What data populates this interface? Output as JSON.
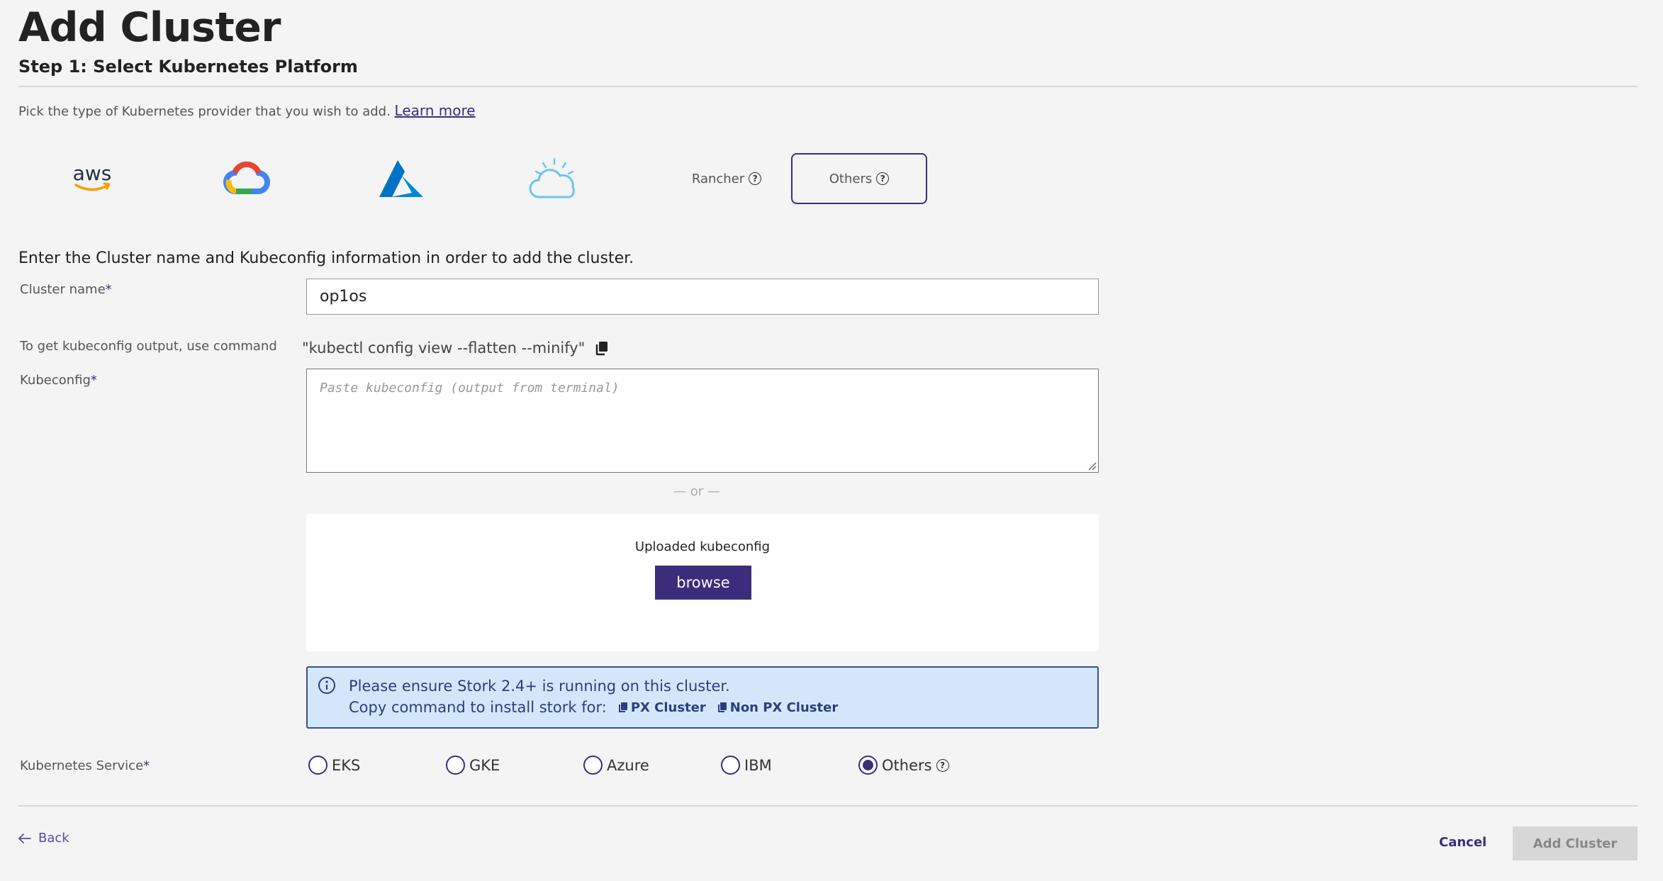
{
  "header": {
    "title": "Add Cluster",
    "step": "Step 1: Select Kubernetes Platform"
  },
  "intro": {
    "text": "Pick the type of Kubernetes provider that you wish to add.",
    "learn_more": "Learn more"
  },
  "providers": {
    "aws_icon": "aws-logo",
    "gcp_icon": "google-cloud-logo",
    "azure_icon": "azure-logo",
    "ibm_icon": "ibm-cloud-logo",
    "rancher": "Rancher",
    "others": "Others"
  },
  "form": {
    "intro": "Enter the Cluster name and Kubeconfig information in order to add the cluster.",
    "cluster_name_label": "Cluster name",
    "required_mark": "*",
    "cluster_name_value": "op1os",
    "kubeconfig_hint_label": "To get kubeconfig output, use command",
    "kubeconfig_command": "\"kubectl config view --flatten --minify\"",
    "kubeconfig_label": "Kubeconfig",
    "kubeconfig_placeholder": "Paste kubeconfig (output from terminal)",
    "or_text": "— or —",
    "upload_label": "Uploaded kubeconfig",
    "browse_label": "browse"
  },
  "info": {
    "line1": "Please ensure Stork 2.4+ is running on this cluster.",
    "line2": "Copy command to install stork for:",
    "px_link": "PX Cluster",
    "non_px_link": "Non PX Cluster"
  },
  "service": {
    "label": "Kubernetes Service",
    "options": [
      "EKS",
      "GKE",
      "Azure",
      "IBM",
      "Others"
    ],
    "selected": "Others"
  },
  "footer": {
    "back": "Back",
    "cancel": "Cancel",
    "add": "Add Cluster"
  },
  "colors": {
    "accent": "#3b2d7c",
    "info_bg": "#d3e7fb",
    "page_bg": "#f4f4f4"
  }
}
